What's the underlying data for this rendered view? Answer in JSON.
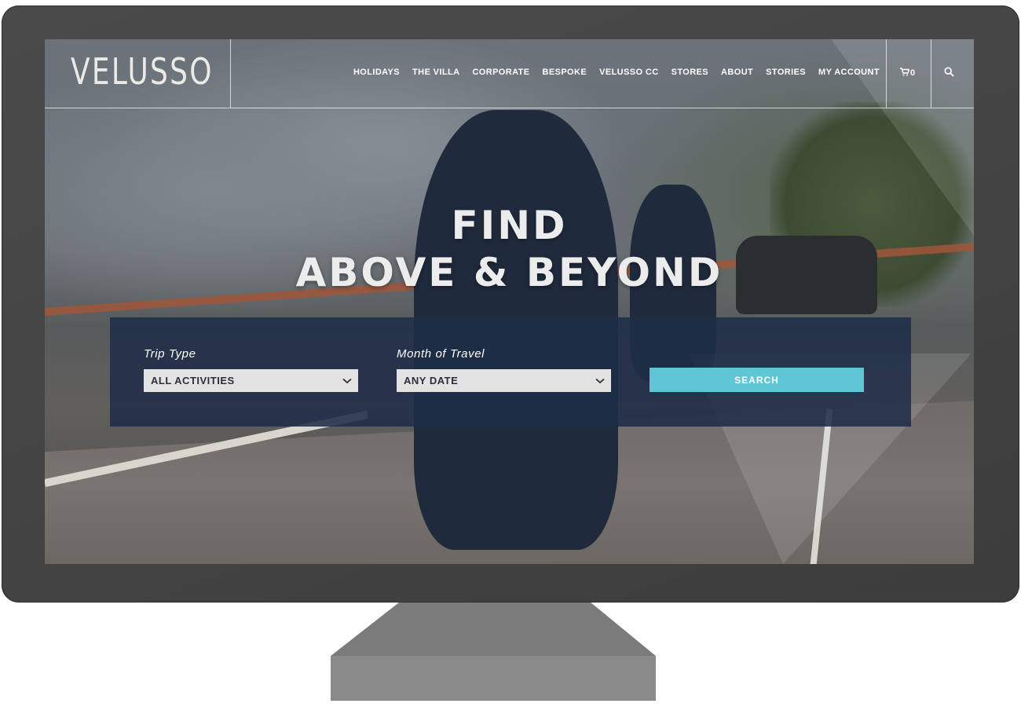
{
  "brand": {
    "logo_text": "VELUSSO"
  },
  "nav": {
    "items": [
      {
        "label": "HOLIDAYS"
      },
      {
        "label": "THE VILLA"
      },
      {
        "label": "CORPORATE"
      },
      {
        "label": "BESPOKE"
      },
      {
        "label": "VELUSSO CC"
      },
      {
        "label": "STORES"
      },
      {
        "label": "ABOUT"
      },
      {
        "label": "STORIES"
      },
      {
        "label": "MY ACCOUNT"
      }
    ],
    "cart_count": "0",
    "cart_icon": "cart-icon",
    "search_icon": "search-icon"
  },
  "hero": {
    "line1": "FIND",
    "line2": "ABOVE & BEYOND"
  },
  "search_panel": {
    "trip_type_label": "Trip Type",
    "trip_type_value": "ALL ACTIVITIES",
    "month_label": "Month of Travel",
    "month_value": "ANY DATE",
    "search_label": "SEARCH"
  },
  "colors": {
    "panel": "#1f2e48",
    "accent": "#5fc6d5",
    "monitor_bezel": "#454545"
  }
}
